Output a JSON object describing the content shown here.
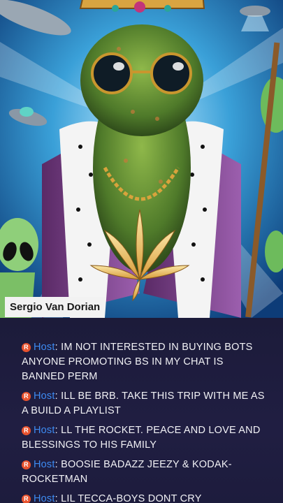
{
  "stream": {
    "streamer_name": "Sergio Van Dorian",
    "artwork_icon": "cannabis-king-artwork"
  },
  "chat": {
    "role_badge": "R",
    "role_color": "#3d8bf2",
    "badge_color": "#e8532f",
    "messages": [
      {
        "role": "Host",
        "text": "IM NOT INTERESTED IN BUYING BOTS ANYONE PROMOTING BS IN MY CHAT IS BANNED PERM"
      },
      {
        "role": "Host",
        "text": "ILL BE BRB. TAKE THIS TRIP WITH ME AS A BUILD A PLAYLIST"
      },
      {
        "role": "Host",
        "text": "LL THE ROCKET. PEACE AND LOVE AND BLESSINGS TO HIS FAMILY"
      },
      {
        "role": "Host",
        "text": "BOOSIE BADAZZ JEEZY & KODAK-ROCKETMAN"
      },
      {
        "role": "Host",
        "text": "LIL TECCA-BOYS DONT CRY"
      }
    ]
  }
}
